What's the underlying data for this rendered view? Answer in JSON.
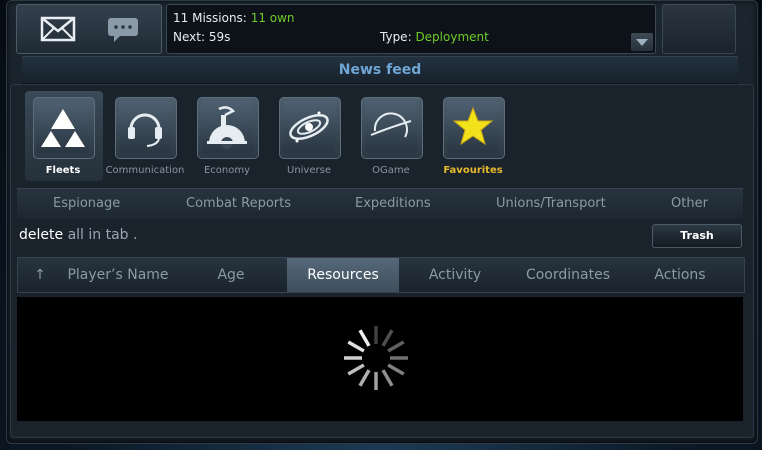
{
  "top_bar": {
    "missions_label": "11 Missions:",
    "missions_own": "11 own",
    "next_label": "Next: 59s",
    "type_label": "Type:",
    "type_value": "Deployment"
  },
  "header": {
    "title": "News feed"
  },
  "categories": [
    {
      "label": "Fleets",
      "icon": "fleets-icon",
      "active": true
    },
    {
      "label": "Communication",
      "icon": "headset-icon"
    },
    {
      "label": "Economy",
      "icon": "factory-gear-icon"
    },
    {
      "label": "Universe",
      "icon": "galaxy-icon"
    },
    {
      "label": "OGame",
      "icon": "planet-ring-icon"
    },
    {
      "label": "Favourites",
      "icon": "star-icon"
    }
  ],
  "subtabs": [
    "Espionage",
    "Combat Reports",
    "Expeditions",
    "Unions/Transport",
    "Other"
  ],
  "actions": {
    "delete_label": "delete",
    "delete_scope": "all in tab .",
    "trash_label": "Trash"
  },
  "columns": [
    "↑",
    "Player’s Name",
    "Age",
    "Resources",
    "Activity",
    "Coordinates",
    "Actions"
  ],
  "active_column": "Resources",
  "colors": {
    "accent_green": "#6ecb28",
    "title_blue": "#6fa6d6",
    "favourite_gold": "#e8b92c"
  }
}
